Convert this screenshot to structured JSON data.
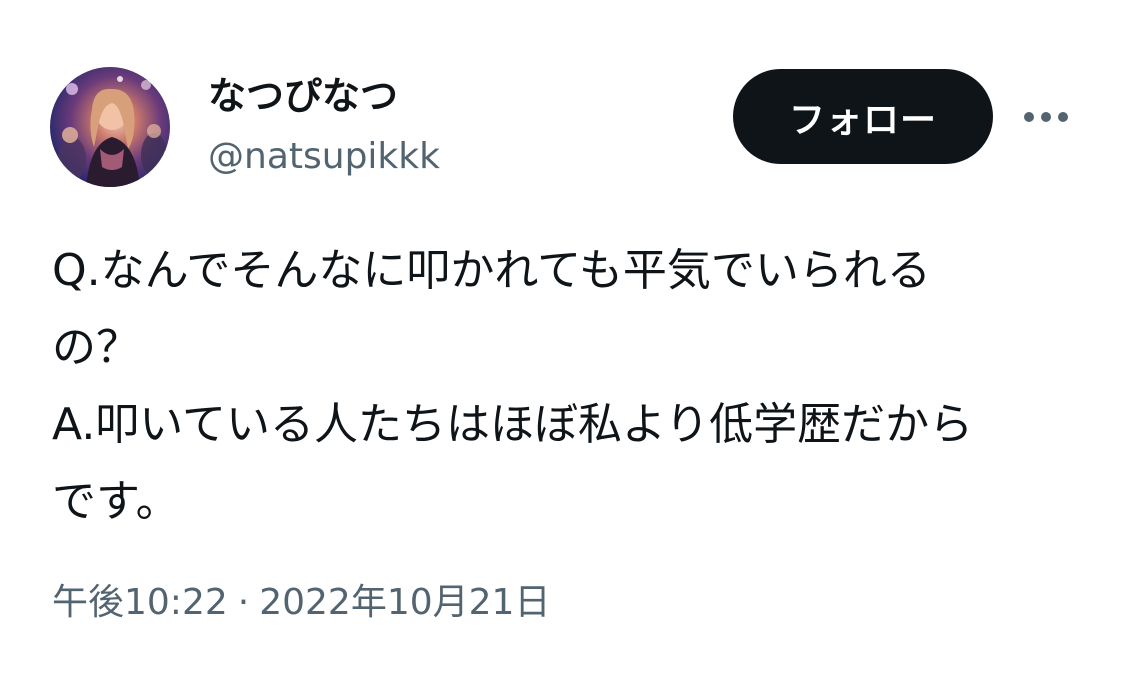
{
  "user": {
    "display_name": "なつぴなつ",
    "handle": "@natsupikkk",
    "avatar_icon": "user-avatar-photo"
  },
  "actions": {
    "follow_label": "フォロー",
    "more_icon": "more-horizontal-icon"
  },
  "tweet": {
    "lines": [
      "Q.なんでそんなに叩かれても平気でいられる",
      "の？",
      "A.叩いている人たちはほぼ私より低学歴だから",
      "です。"
    ]
  },
  "meta": {
    "time": "午後10:22",
    "separator": "·",
    "date": "2022年10月21日"
  },
  "colors": {
    "text_primary": "#0f1419",
    "text_secondary": "#536471",
    "follow_button_bg": "#0f1419",
    "follow_button_text": "#ffffff",
    "background": "#ffffff"
  }
}
